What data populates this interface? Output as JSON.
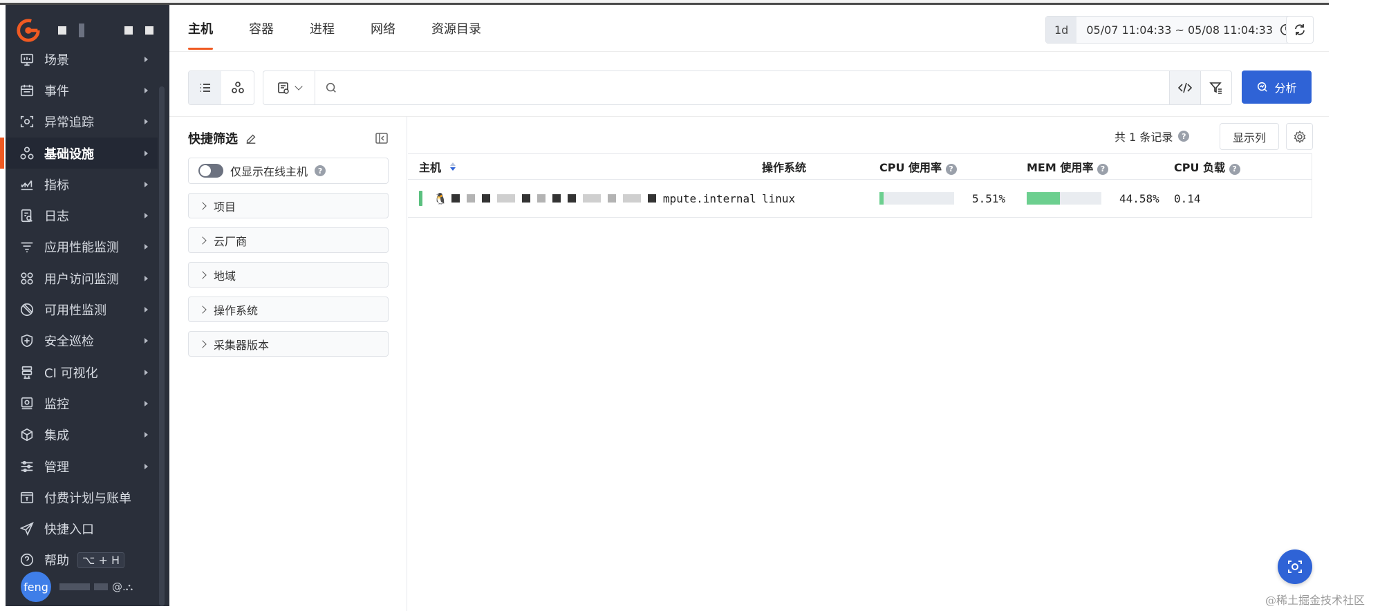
{
  "sidebar": {
    "items": [
      {
        "label": "场景",
        "icon": "monitor-icon"
      },
      {
        "label": "事件",
        "icon": "calendar-icon"
      },
      {
        "label": "异常追踪",
        "icon": "scan-icon"
      },
      {
        "label": "基础设施",
        "icon": "cluster-icon",
        "active": true
      },
      {
        "label": "指标",
        "icon": "chart-icon"
      },
      {
        "label": "日志",
        "icon": "log-icon"
      },
      {
        "label": "应用性能监测",
        "icon": "list-icon"
      },
      {
        "label": "用户访问监测",
        "icon": "grid-icon"
      },
      {
        "label": "可用性监测",
        "icon": "ban-icon"
      },
      {
        "label": "安全巡检",
        "icon": "shield-icon"
      },
      {
        "label": "CI 可视化",
        "icon": "stack-icon"
      },
      {
        "label": "监控",
        "icon": "monitor-screen-icon"
      },
      {
        "label": "集成",
        "icon": "cube-icon"
      },
      {
        "label": "管理",
        "icon": "sliders-icon"
      }
    ],
    "extra_items": [
      {
        "label": "付费计划与账单",
        "icon": "bill-icon"
      },
      {
        "label": "快捷入口",
        "icon": "send-icon"
      }
    ],
    "help": {
      "label": "帮助",
      "shortcut": "⌥ + H"
    },
    "user": {
      "avatar_text": "feng",
      "suffix": "@.⛬"
    }
  },
  "tabs": [
    "主机",
    "容器",
    "进程",
    "网络",
    "资源目录"
  ],
  "time": {
    "preset": "1d",
    "range": "05/07 11:04:33 ~ 05/08 11:04:33"
  },
  "toolbar": {
    "analyze_label": "分析"
  },
  "filter": {
    "title": "快捷筛选",
    "online_toggle_label": "仅显示在线主机",
    "facets": [
      "项目",
      "云厂商",
      "地域",
      "操作系统",
      "采集器版本"
    ]
  },
  "table": {
    "count_text": "共 1 条记录",
    "show_columns_label": "显示列",
    "headers": [
      "主机",
      "操作系统",
      "CPU 使用率",
      "MEM 使用率",
      "CPU 负载"
    ],
    "rows": [
      {
        "host_suffix": "mpute.internal",
        "os": "linux",
        "cpu": "5.51%",
        "cpu_pct": 5.51,
        "mem": "44.58%",
        "mem_pct": 44.58,
        "load": "0.14"
      }
    ]
  },
  "watermark": "@稀土掘金技术社区",
  "colors": {
    "accent": "#f05a22",
    "primary": "#2f63d6",
    "sidebar": "#2a2f3a",
    "bar": "#6ccf8f"
  }
}
